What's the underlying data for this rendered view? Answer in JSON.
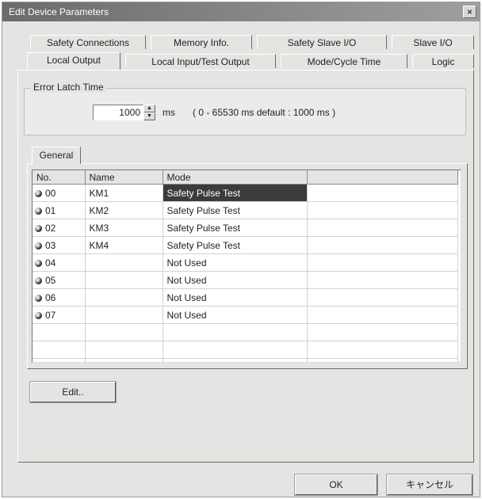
{
  "window": {
    "title": "Edit Device Parameters",
    "close": "×"
  },
  "tabs_row1": [
    "Safety Connections",
    "Memory Info.",
    "Safety Slave I/O",
    "Slave I/O"
  ],
  "tabs_row2": [
    "Local Output",
    "Local Input/Test Output",
    "Mode/Cycle Time",
    "Logic"
  ],
  "active_tab": "Local Output",
  "error_latch": {
    "legend": "Error Latch Time",
    "value": "1000",
    "unit": "ms",
    "range": "( 0 - 65530 ms   default : 1000 ms )"
  },
  "inner_tab": "General",
  "table": {
    "headers": [
      "No.",
      "Name",
      "Mode",
      ""
    ],
    "rows": [
      {
        "no": "00",
        "name": "KM1",
        "mode": "Safety Pulse Test",
        "selected": true
      },
      {
        "no": "01",
        "name": "KM2",
        "mode": "Safety Pulse Test",
        "selected": false
      },
      {
        "no": "02",
        "name": "KM3",
        "mode": "Safety Pulse Test",
        "selected": false
      },
      {
        "no": "03",
        "name": "KM4",
        "mode": "Safety Pulse Test",
        "selected": false
      },
      {
        "no": "04",
        "name": "",
        "mode": "Not Used",
        "selected": false
      },
      {
        "no": "05",
        "name": "",
        "mode": "Not Used",
        "selected": false
      },
      {
        "no": "06",
        "name": "",
        "mode": "Not Used",
        "selected": false
      },
      {
        "no": "07",
        "name": "",
        "mode": "Not Used",
        "selected": false
      }
    ],
    "empty_rows": 3
  },
  "buttons": {
    "edit": "Edit..",
    "ok": "OK",
    "cancel": "キャンセル"
  }
}
